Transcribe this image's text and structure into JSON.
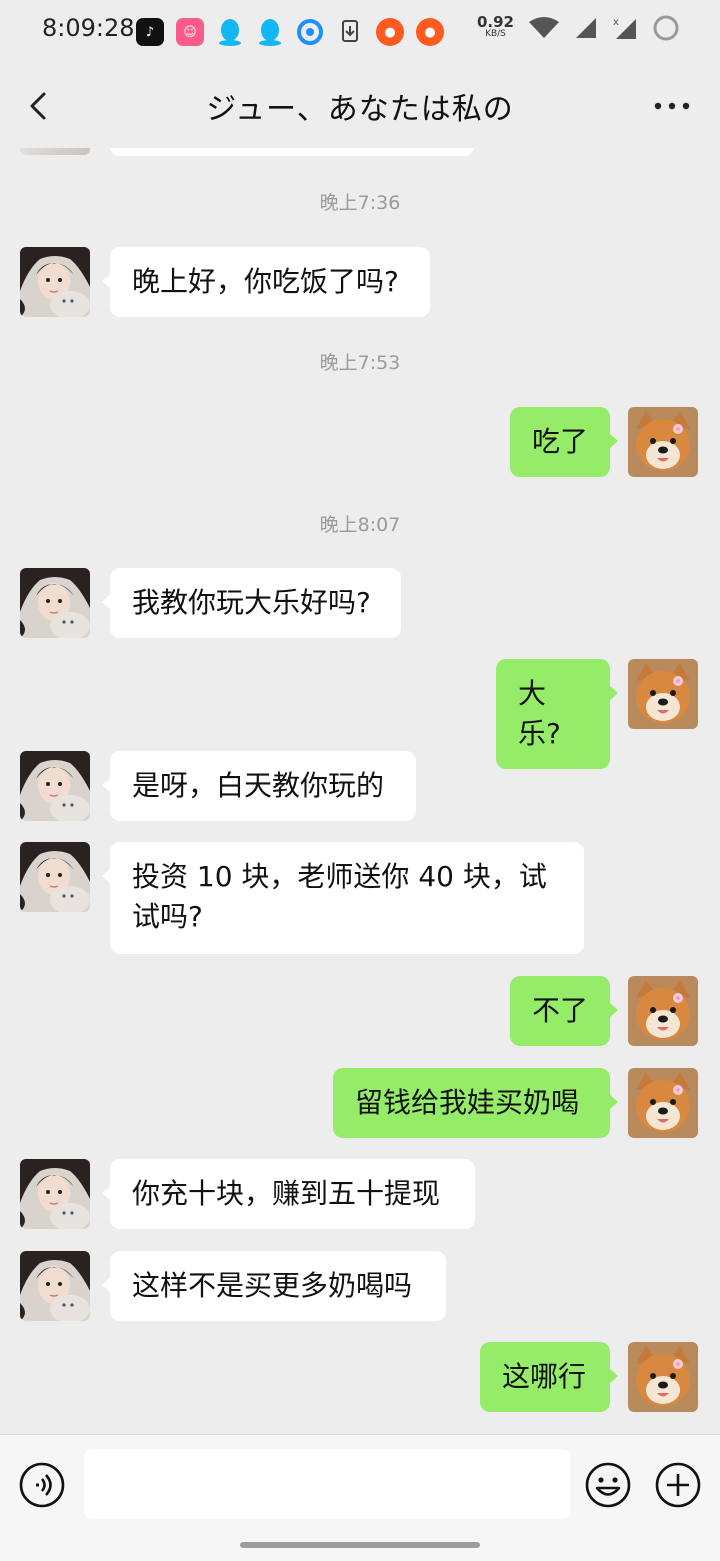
{
  "status_bar": {
    "time": "8:09:28",
    "net_speed_value": "0.92",
    "net_speed_unit": "KB/S",
    "apps": [
      "tiktok-icon",
      "tieba-icon",
      "qq-icon",
      "qq-icon",
      "browser-icon",
      "download-icon",
      "kuaishou-icon",
      "kuaishou-icon"
    ]
  },
  "header": {
    "title": "ジュー、あなたは私の"
  },
  "messages": [
    {
      "type": "time",
      "text": "晚上7:36"
    },
    {
      "type": "msg",
      "side": "left",
      "text": "晚上好，你吃饭了吗?"
    },
    {
      "type": "time",
      "text": "晚上7:53"
    },
    {
      "type": "msg",
      "side": "right",
      "text": "吃了"
    },
    {
      "type": "time",
      "text": "晚上8:07"
    },
    {
      "type": "msg",
      "side": "left",
      "text": "我教你玩大乐好吗?"
    },
    {
      "type": "msg",
      "side": "right",
      "text": "大乐?"
    },
    {
      "type": "msg",
      "side": "left",
      "text": "是呀，白天教你玩的"
    },
    {
      "type": "msg",
      "side": "left",
      "text": "投资 10 块，老师送你 40 块，试试吗?"
    },
    {
      "type": "msg",
      "side": "right",
      "text": "不了"
    },
    {
      "type": "msg",
      "side": "right",
      "text": "留钱给我娃买奶喝"
    },
    {
      "type": "msg",
      "side": "left",
      "text": "你充十块，赚到五十提现"
    },
    {
      "type": "msg",
      "side": "left",
      "text": "这样不是买更多奶喝吗"
    },
    {
      "type": "msg",
      "side": "right",
      "text": "这哪行"
    }
  ],
  "input_bar": {
    "placeholder": ""
  },
  "colors": {
    "background": "#ededed",
    "bubble_self": "#95ec69",
    "bubble_other": "#ffffff",
    "timestamp": "#9a9a9a"
  }
}
